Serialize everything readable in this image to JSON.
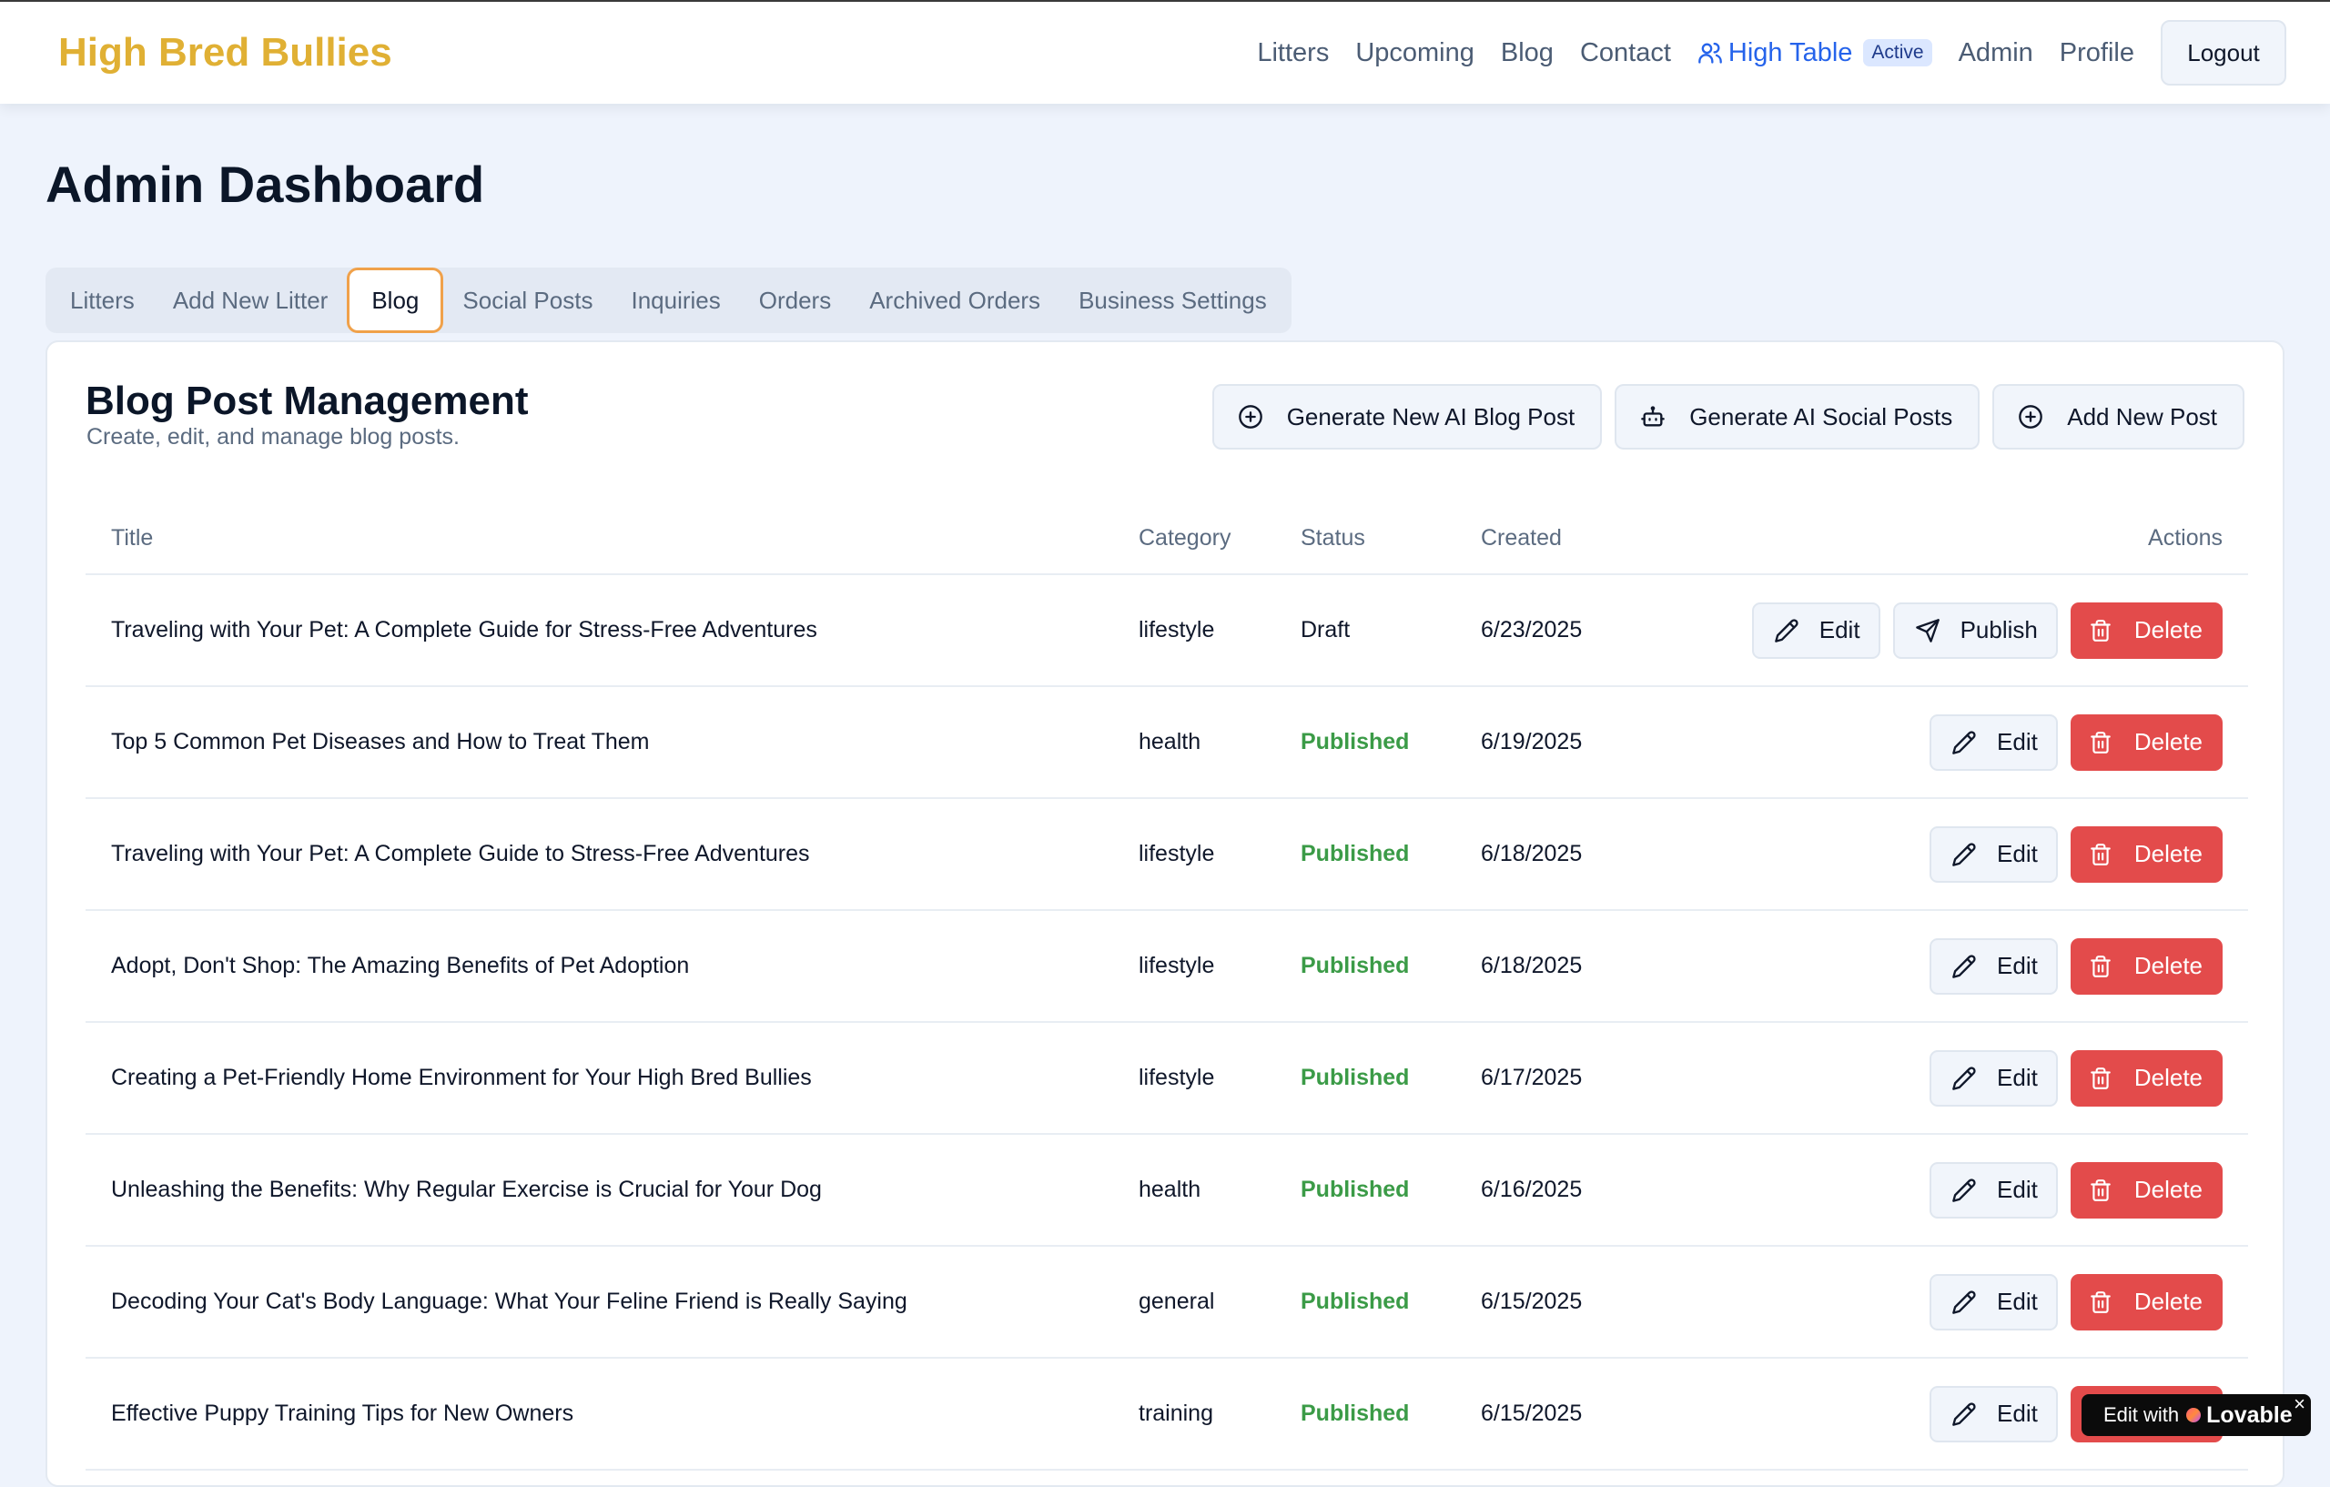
{
  "brand": "High Bred Bullies",
  "nav": {
    "links": [
      "Litters",
      "Upcoming",
      "Blog",
      "Contact"
    ],
    "highlight": {
      "label": "High Table",
      "badge": "Active",
      "icon": "users-icon"
    },
    "links_after": [
      "Admin",
      "Profile"
    ],
    "logout": "Logout"
  },
  "page_title": "Admin Dashboard",
  "tabs": [
    "Litters",
    "Add New Litter",
    "Blog",
    "Social Posts",
    "Inquiries",
    "Orders",
    "Archived Orders",
    "Business Settings"
  ],
  "active_tab": "Blog",
  "card": {
    "title": "Blog Post Management",
    "subtitle": "Create, edit, and manage blog posts.",
    "actions": [
      {
        "label": "Generate New AI Blog Post",
        "icon": "plus-circle-icon"
      },
      {
        "label": "Generate AI Social Posts",
        "icon": "bot-icon"
      },
      {
        "label": "Add New Post",
        "icon": "plus-circle-icon"
      }
    ]
  },
  "table": {
    "headers": {
      "title": "Title",
      "category": "Category",
      "status": "Status",
      "created": "Created",
      "actions": "Actions"
    },
    "rows": [
      {
        "title": "Traveling with Your Pet: A Complete Guide for Stress-Free Adventures",
        "category": "lifestyle",
        "status": "Draft",
        "created": "6/23/2025"
      },
      {
        "title": "Top 5 Common Pet Diseases and How to Treat Them",
        "category": "health",
        "status": "Published",
        "created": "6/19/2025"
      },
      {
        "title": "Traveling with Your Pet: A Complete Guide to Stress-Free Adventures",
        "category": "lifestyle",
        "status": "Published",
        "created": "6/18/2025"
      },
      {
        "title": "Adopt, Don't Shop: The Amazing Benefits of Pet Adoption",
        "category": "lifestyle",
        "status": "Published",
        "created": "6/18/2025"
      },
      {
        "title": "Creating a Pet-Friendly Home Environment for Your High Bred Bullies",
        "category": "lifestyle",
        "status": "Published",
        "created": "6/17/2025"
      },
      {
        "title": "Unleashing the Benefits: Why Regular Exercise is Crucial for Your Dog",
        "category": "health",
        "status": "Published",
        "created": "6/16/2025"
      },
      {
        "title": "Decoding Your Cat's Body Language: What Your Feline Friend is Really Saying",
        "category": "general",
        "status": "Published",
        "created": "6/15/2025"
      },
      {
        "title": "Effective Puppy Training Tips for New Owners",
        "category": "training",
        "status": "Published",
        "created": "6/15/2025"
      }
    ],
    "action_labels": {
      "edit": "Edit",
      "publish": "Publish",
      "delete": "Delete"
    }
  },
  "lovable_badge": {
    "prefix": "Edit with",
    "brand": "Lovable",
    "close": "×"
  },
  "colors": {
    "brand": "#e0b034",
    "accent": "#2563eb",
    "published": "#3b9b47",
    "delete": "#e34b4b",
    "active_tab_border": "#f0a14a"
  }
}
